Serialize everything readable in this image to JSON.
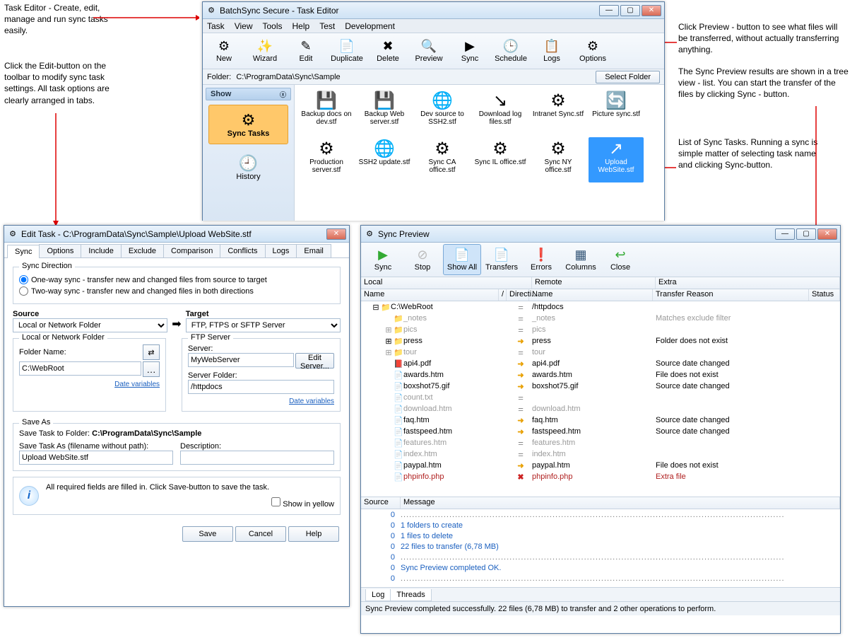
{
  "annotations": {
    "task_editor": "Task Editor - Create, edit, manage and run sync tasks easily.",
    "edit_button": "Click the Edit-button on the toolbar to modify sync task settings. All task options are clearly arranged in tabs.",
    "preview_button": "Click Preview - button to see what files will be transferred, without actually transferring anything.",
    "preview_tree": "The Sync Preview results are shown in a tree view - list. You can start the transfer of the files by clicking Sync - button.",
    "task_list": "List of Sync Tasks. Running a sync is simple matter of selecting task name and clicking Sync-button."
  },
  "main_window": {
    "title": "BatchSync Secure - Task Editor",
    "menu": [
      "Task",
      "View",
      "Tools",
      "Help",
      "Test",
      "Development"
    ],
    "toolbar": [
      {
        "id": "new",
        "label": "New",
        "icon": "⚙"
      },
      {
        "id": "wizard",
        "label": "Wizard",
        "icon": "✨"
      },
      {
        "id": "edit",
        "label": "Edit",
        "icon": "✎"
      },
      {
        "id": "duplicate",
        "label": "Duplicate",
        "icon": "📄"
      },
      {
        "id": "delete",
        "label": "Delete",
        "icon": "✖"
      },
      {
        "id": "preview",
        "label": "Preview",
        "icon": "🔍"
      },
      {
        "id": "sync",
        "label": "Sync",
        "icon": "▶"
      },
      {
        "id": "schedule",
        "label": "Schedule",
        "icon": "🕒"
      },
      {
        "id": "logs",
        "label": "Logs",
        "icon": "📋"
      },
      {
        "id": "options",
        "label": "Options",
        "icon": "⚙"
      }
    ],
    "folder_label": "Folder:",
    "folder_path": "C:\\ProgramData\\Sync\\Sample",
    "select_folder": "Select Folder",
    "side_head": "Show",
    "side_items": [
      {
        "label": "Sync Tasks",
        "selected": true,
        "icon": "⚙"
      },
      {
        "label": "History",
        "selected": false,
        "icon": "🕘"
      }
    ],
    "tasks": [
      {
        "name": "Backup docs on dev.stf",
        "icon": "💾"
      },
      {
        "name": "Backup Web server.stf",
        "icon": "💾"
      },
      {
        "name": "Dev source to SSH2.stf",
        "icon": "🌐"
      },
      {
        "name": "Download log files.stf",
        "icon": "↘"
      },
      {
        "name": "Intranet Sync.stf",
        "icon": "⚙"
      },
      {
        "name": "Picture sync.stf",
        "icon": "🔄"
      },
      {
        "name": "Production server.stf",
        "icon": "⚙"
      },
      {
        "name": "SSH2 update.stf",
        "icon": "🌐"
      },
      {
        "name": "Sync CA office.stf",
        "icon": "⚙"
      },
      {
        "name": "Sync IL office.stf",
        "icon": "⚙"
      },
      {
        "name": "Sync NY office.stf",
        "icon": "⚙"
      },
      {
        "name": "Upload WebSite.stf",
        "icon": "↗",
        "selected": true
      }
    ]
  },
  "edit_dialog": {
    "title": "Edit Task - C:\\ProgramData\\Sync\\Sample\\Upload WebSite.stf",
    "tabs": [
      "Sync",
      "Options",
      "Include",
      "Exclude",
      "Comparison",
      "Conflicts",
      "Logs",
      "Email"
    ],
    "active_tab": "Sync",
    "direction_legend": "Sync Direction",
    "one_way": "One-way sync - transfer new and changed files from source to target",
    "two_way": "Two-way sync - transfer new and changed files in both directions",
    "source": "Source",
    "target": "Target",
    "source_type": "Local or Network Folder",
    "target_type": "FTP, FTPS or SFTP Server",
    "local_folder_legend": "Local or Network Folder",
    "folder_name_label": "Folder Name:",
    "folder_name": "C:\\WebRoot",
    "ftp_legend": "FTP Server",
    "server_label": "Server:",
    "server": "MyWebServer",
    "edit_server": "Edit Server...",
    "server_folder_label": "Server Folder:",
    "server_folder": "/httpdocs",
    "date_vars": "Date variables",
    "saveas_legend": "Save As",
    "save_folder_label": "Save Task to Folder:",
    "save_folder": "C:\\ProgramData\\Sync\\Sample",
    "filename_label": "Save Task As (filename without path):",
    "filename": "Upload WebSite.stf",
    "desc_label": "Description:",
    "info_msg": "All required fields are filled in. Click Save-button to save the task.",
    "show_yellow": "Show in yellow",
    "btn_save": "Save",
    "btn_cancel": "Cancel",
    "btn_help": "Help"
  },
  "preview": {
    "title": "Sync Preview",
    "toolbar": [
      {
        "id": "sync",
        "label": "Sync",
        "icon": "▶",
        "color": "#3a3"
      },
      {
        "id": "stop",
        "label": "Stop",
        "icon": "⊘",
        "color": "#bbb"
      },
      {
        "id": "showall",
        "label": "Show All",
        "icon": "📄",
        "active": true
      },
      {
        "id": "transfers",
        "label": "Transfers",
        "icon": "📄"
      },
      {
        "id": "errors",
        "label": "Errors",
        "icon": "❗",
        "color": "#d60"
      },
      {
        "id": "columns",
        "label": "Columns",
        "icon": "▦"
      },
      {
        "id": "close",
        "label": "Close",
        "icon": "↩",
        "color": "#3a3"
      }
    ],
    "headers": {
      "local": "Local",
      "remote": "Remote",
      "extra": "Extra",
      "name": "Name",
      "direction": "Directi...",
      "rname": "Name",
      "reason": "Transfer Reason",
      "status": "Status"
    },
    "rows": [
      {
        "indent": 0,
        "name": "C:\\WebRoot",
        "dir": "eq",
        "rname": "/httpdocs",
        "reason": "",
        "exp": "minus",
        "folder": true
      },
      {
        "indent": 1,
        "name": "_notes",
        "dir": "eq",
        "rname": "_notes",
        "reason": "Matches exclude filter",
        "gray": true,
        "folder": true
      },
      {
        "indent": 1,
        "name": "pics",
        "dir": "eq",
        "rname": "pics",
        "reason": "",
        "gray": true,
        "exp": "plus",
        "folder": true
      },
      {
        "indent": 1,
        "name": "press",
        "dir": "arr",
        "rname": "press",
        "reason": "Folder does not exist",
        "exp": "plus",
        "folder": true
      },
      {
        "indent": 1,
        "name": "tour",
        "dir": "eq",
        "rname": "tour",
        "reason": "",
        "gray": true,
        "exp": "plus",
        "folder": true
      },
      {
        "indent": 1,
        "name": "api4.pdf",
        "dir": "arr",
        "rname": "api4.pdf",
        "reason": "Source date changed",
        "pdf": true
      },
      {
        "indent": 1,
        "name": "awards.htm",
        "dir": "arr",
        "rname": "awards.htm",
        "reason": "File does not exist"
      },
      {
        "indent": 1,
        "name": "boxshot75.gif",
        "dir": "arr",
        "rname": "boxshot75.gif",
        "reason": "Source date changed"
      },
      {
        "indent": 1,
        "name": "count.txt",
        "dir": "eq",
        "rname": "",
        "reason": "",
        "gray": true
      },
      {
        "indent": 1,
        "name": "download.htm",
        "dir": "eq",
        "rname": "download.htm",
        "reason": "",
        "gray": true
      },
      {
        "indent": 1,
        "name": "faq.htm",
        "dir": "arr",
        "rname": "faq.htm",
        "reason": "Source date changed"
      },
      {
        "indent": 1,
        "name": "fastspeed.htm",
        "dir": "arr",
        "rname": "fastspeed.htm",
        "reason": "Source date changed"
      },
      {
        "indent": 1,
        "name": "features.htm",
        "dir": "eq",
        "rname": "features.htm",
        "reason": "",
        "gray": true
      },
      {
        "indent": 1,
        "name": "index.htm",
        "dir": "eq",
        "rname": "index.htm",
        "reason": "",
        "gray": true
      },
      {
        "indent": 1,
        "name": "paypal.htm",
        "dir": "arr",
        "rname": "paypal.htm",
        "reason": "File does not exist"
      },
      {
        "indent": 1,
        "name": "phpinfo.php",
        "dir": "x",
        "rname": "phpinfo.php",
        "reason": "Extra file",
        "red": true
      }
    ],
    "log_headers": {
      "source": "Source",
      "message": "Message"
    },
    "log": [
      {
        "s": "0",
        "m": "......................................................................................................................................",
        "dotted": true
      },
      {
        "s": "0",
        "m": "1 folders to create"
      },
      {
        "s": "0",
        "m": "1 files to delete"
      },
      {
        "s": "0",
        "m": "22 files to transfer (6,78 MB)"
      },
      {
        "s": "0",
        "m": "......................................................................................................................................",
        "dotted": true
      },
      {
        "s": "0",
        "m": "Sync Preview completed OK."
      },
      {
        "s": "0",
        "m": "......................................................................................................................................",
        "dotted": true
      }
    ],
    "bottom_tabs": [
      "Log",
      "Threads"
    ],
    "status": "Sync Preview completed successfully. 22 files (6,78 MB) to transfer and 2 other operations to perform."
  }
}
